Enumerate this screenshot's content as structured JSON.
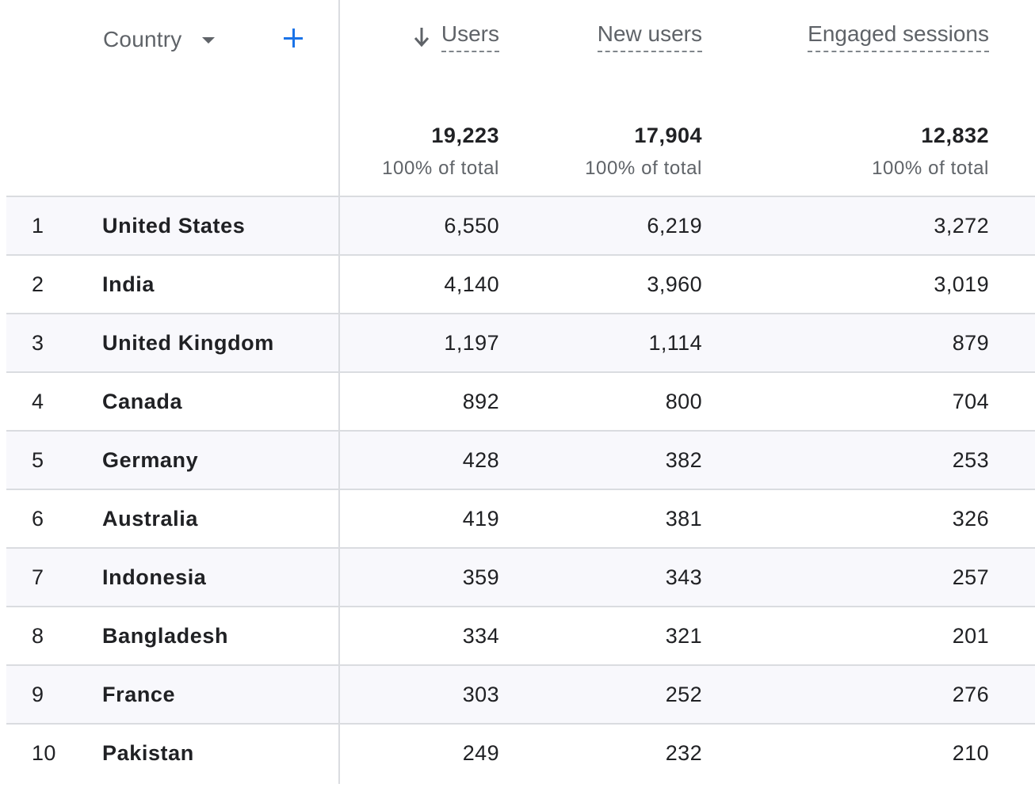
{
  "dimension": {
    "label": "Country"
  },
  "metrics": [
    {
      "label": "Users",
      "total": "19,223",
      "pct": "100% of total"
    },
    {
      "label": "New users",
      "total": "17,904",
      "pct": "100% of total"
    },
    {
      "label": "Engaged sessions",
      "total": "12,832",
      "pct": "100% of total"
    }
  ],
  "rows": [
    {
      "index": "1",
      "country": "United States",
      "users": "6,550",
      "new_users": "6,219",
      "engaged_sessions": "3,272"
    },
    {
      "index": "2",
      "country": "India",
      "users": "4,140",
      "new_users": "3,960",
      "engaged_sessions": "3,019"
    },
    {
      "index": "3",
      "country": "United Kingdom",
      "users": "1,197",
      "new_users": "1,114",
      "engaged_sessions": "879"
    },
    {
      "index": "4",
      "country": "Canada",
      "users": "892",
      "new_users": "800",
      "engaged_sessions": "704"
    },
    {
      "index": "5",
      "country": "Germany",
      "users": "428",
      "new_users": "382",
      "engaged_sessions": "253"
    },
    {
      "index": "6",
      "country": "Australia",
      "users": "419",
      "new_users": "381",
      "engaged_sessions": "326"
    },
    {
      "index": "7",
      "country": "Indonesia",
      "users": "359",
      "new_users": "343",
      "engaged_sessions": "257"
    },
    {
      "index": "8",
      "country": "Bangladesh",
      "users": "334",
      "new_users": "321",
      "engaged_sessions": "201"
    },
    {
      "index": "9",
      "country": "France",
      "users": "303",
      "new_users": "252",
      "engaged_sessions": "276"
    },
    {
      "index": "10",
      "country": "Pakistan",
      "users": "249",
      "new_users": "232",
      "engaged_sessions": "210"
    }
  ],
  "icons": {
    "sort": "arrow-down-icon",
    "dimension_menu": "caret-down-icon",
    "add_dimension": "plus-icon"
  },
  "colors": {
    "accent": "#1a73e8",
    "text": "#202124",
    "muted": "#5f6368",
    "border": "#dadce0",
    "alt_row": "#f8f8fc"
  }
}
